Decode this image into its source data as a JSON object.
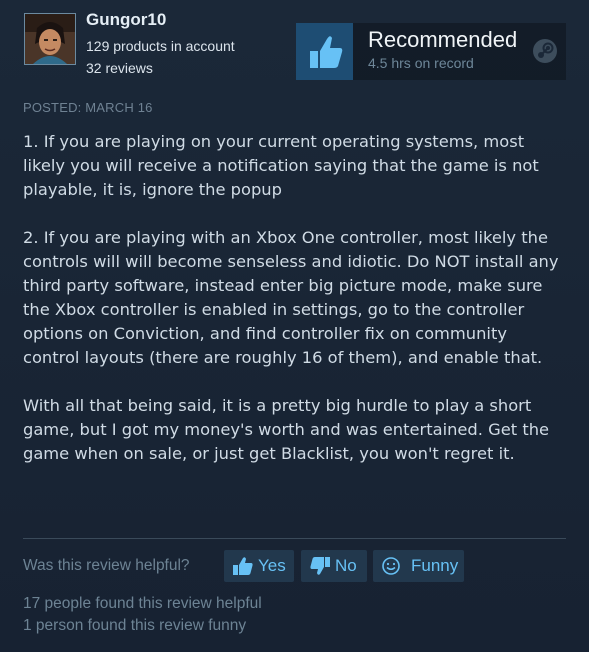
{
  "author": {
    "username": "Gungor10",
    "products": "129 products in account",
    "reviews": "32 reviews"
  },
  "recommendation": {
    "verdict": "Recommended",
    "hours": "4.5 hrs on record",
    "thumb_icon": "thumbs-up-icon",
    "platform_icon": "steam-icon",
    "accent_color": "#1e4d73"
  },
  "posted": "POSTED: MARCH 16",
  "body": {
    "p1": "1. If you are playing on your current operating systems, most likely you will receive a notification saying that the game is not playable, it is, ignore the popup",
    "p2": "2. If you are playing with an Xbox One controller, most likely the controls will will become senseless and idiotic. Do NOT install any third party software, instead enter big picture mode, make sure the Xbox controller is enabled in settings, go to the controller options on Conviction, and find controller fix on community control layouts (there are roughly 16 of them), and enable that.",
    "p3": "With all that being said, it is a pretty big hurdle to play a short game, but I got my money's worth and was entertained. Get the game when on sale, or just get Blacklist, you won't regret it."
  },
  "feedback": {
    "question": "Was this review helpful?",
    "yes_label": "Yes",
    "no_label": "No",
    "funny_label": "Funny",
    "button_color": "#67c1f5"
  },
  "stats": {
    "helpful": "17 people found this review helpful",
    "funny": "1 person found this review funny"
  }
}
